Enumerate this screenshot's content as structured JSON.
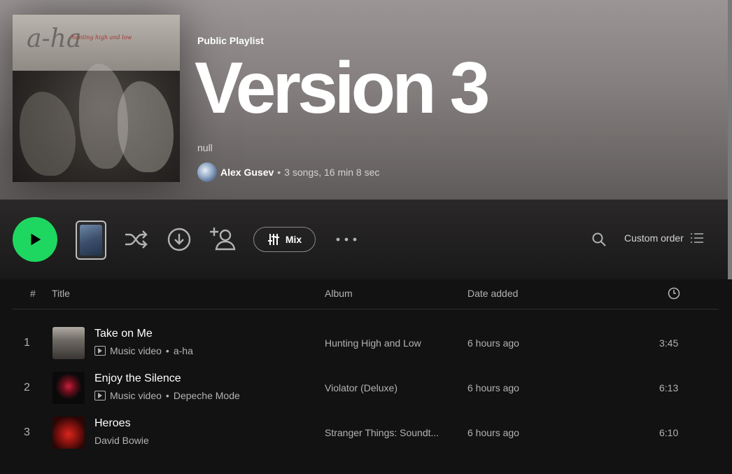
{
  "header": {
    "type_label": "Public Playlist",
    "title": "Version 3",
    "description": "null",
    "owner": "Alex Gusev",
    "separator": "•",
    "counts": "3 songs, 16 min 8 sec",
    "cover": {
      "logo": "a-ha",
      "subtitle": "hunting high and low"
    }
  },
  "actions": {
    "mix_label": "Mix",
    "custom_order_label": "Custom order"
  },
  "table": {
    "headers": {
      "num": "#",
      "title": "Title",
      "album": "Album",
      "date_added": "Date added"
    },
    "rows": [
      {
        "num": "1",
        "title": "Take on Me",
        "is_video": true,
        "video_label": "Music video",
        "artist": "a-ha",
        "album": "Hunting High and Low",
        "added": "6 hours ago",
        "duration": "3:45"
      },
      {
        "num": "2",
        "title": "Enjoy the Silence",
        "is_video": true,
        "video_label": "Music video",
        "artist": "Depeche Mode",
        "album": "Violator (Deluxe)",
        "added": "6 hours ago",
        "duration": "6:13"
      },
      {
        "num": "3",
        "title": "Heroes",
        "is_video": false,
        "artist": "David Bowie",
        "album": "Stranger Things: Soundt...",
        "added": "6 hours ago",
        "duration": "6:10"
      }
    ]
  },
  "colors": {
    "accent": "#1ed760",
    "background": "#121212"
  }
}
